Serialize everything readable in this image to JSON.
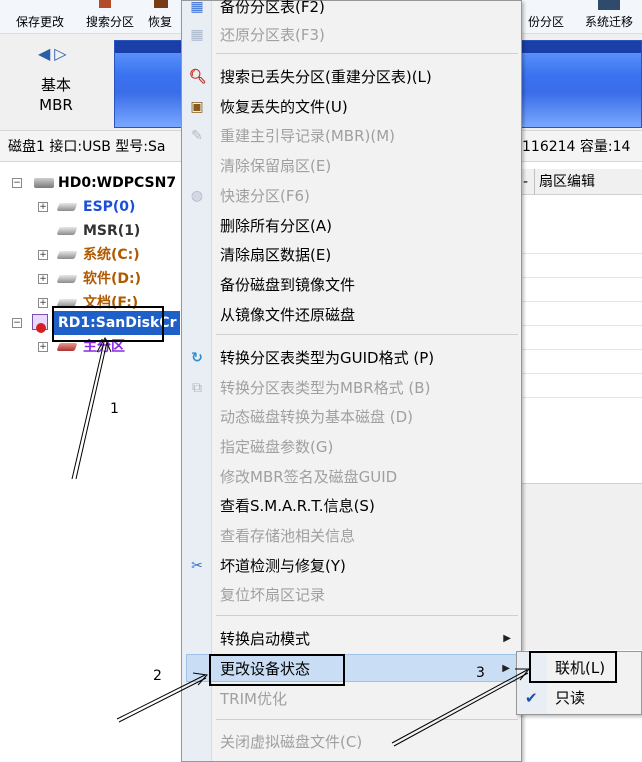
{
  "toolbar": {
    "buttons": [
      "保存更改",
      "搜索分区",
      "恢复",
      "份分区",
      "系统迁移"
    ]
  },
  "nav": {
    "label_top": "基本",
    "label_bottom": "MBR"
  },
  "status": {
    "left": "磁盘1 接口:USB  型号:Sa",
    "right": "116214  容量:14"
  },
  "tree": {
    "disk0": "HD0:WDPCSN7",
    "partitions": [
      "ESP(0)",
      "MSR(1)",
      "系统(C:)",
      "软件(D:)",
      "文档(F:)"
    ],
    "disk1": "RD1:SanDiskCr",
    "disk1_partition": "主分区"
  },
  "right_pane": {
    "header_dash": "-",
    "header_tab": "扇区编辑"
  },
  "menu": {
    "items": [
      {
        "label": "备份分区表(F2)",
        "disabled": false
      },
      {
        "label": "还原分区表(F3)",
        "disabled": true
      },
      {
        "label": "搜索已丢失分区(重建分区表)(L)",
        "disabled": false
      },
      {
        "label": "恢复丢失的文件(U)",
        "disabled": false
      },
      {
        "label": "重建主引导记录(MBR)(M)",
        "disabled": true
      },
      {
        "label": "清除保留扇区(E)",
        "disabled": true
      },
      {
        "label": "快速分区(F6)",
        "disabled": true
      },
      {
        "label": "删除所有分区(A)",
        "disabled": false
      },
      {
        "label": "清除扇区数据(E)",
        "disabled": false
      },
      {
        "label": "备份磁盘到镜像文件",
        "disabled": false
      },
      {
        "label": "从镜像文件还原磁盘",
        "disabled": false
      },
      {
        "label": "转换分区表类型为GUID格式 (P)",
        "disabled": false
      },
      {
        "label": "转换分区表类型为MBR格式 (B)",
        "disabled": true
      },
      {
        "label": "动态磁盘转换为基本磁盘 (D)",
        "disabled": true
      },
      {
        "label": "指定磁盘参数(G)",
        "disabled": true
      },
      {
        "label": "修改MBR签名及磁盘GUID",
        "disabled": true
      },
      {
        "label": "查看S.M.A.R.T.信息(S)",
        "disabled": false
      },
      {
        "label": "查看存储池相关信息",
        "disabled": true
      },
      {
        "label": "坏道检测与修复(Y)",
        "disabled": false
      },
      {
        "label": "复位坏扇区记录",
        "disabled": true
      },
      {
        "label": "转换启动模式",
        "disabled": false
      },
      {
        "label": "更改设备状态",
        "disabled": false
      },
      {
        "label": "TRIM优化",
        "disabled": true
      },
      {
        "label": "关闭虚拟磁盘文件(C)",
        "disabled": true
      }
    ]
  },
  "submenu": {
    "online": "联机(L)",
    "readonly": "只读"
  },
  "annotations": {
    "n1": "1",
    "n2": "2",
    "n3": "3"
  },
  "colors": {
    "accent": "#1e5fc8",
    "partition_text": "#b05a00",
    "partition_blue": "#1c4fd6",
    "main_partition": "#8a2be2"
  }
}
